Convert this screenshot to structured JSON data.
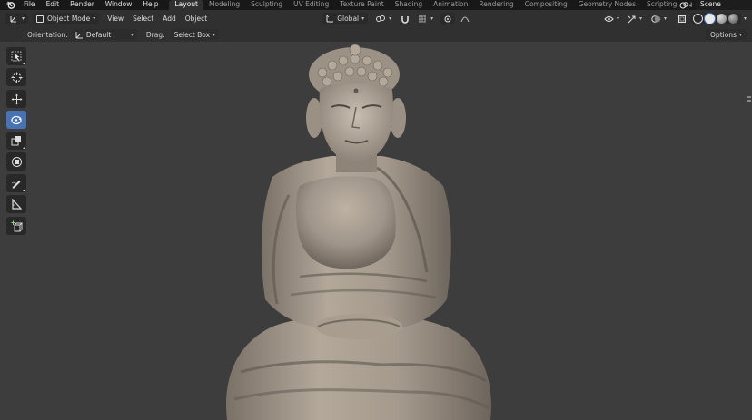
{
  "topbar": {
    "menu": [
      "File",
      "Edit",
      "Render",
      "Window",
      "Help"
    ],
    "workspaces": [
      "Layout",
      "Modeling",
      "Sculpting",
      "UV Editing",
      "Texture Paint",
      "Shading",
      "Animation",
      "Rendering",
      "Compositing",
      "Geometry Nodes",
      "Scripting"
    ],
    "active_workspace": "Layout",
    "add_label": "+",
    "scene_name": "Scene"
  },
  "header": {
    "mode": "Object Mode",
    "menus": [
      "View",
      "Select",
      "Add",
      "Object"
    ],
    "transform_orientation": "Global"
  },
  "tool_settings": {
    "orientation_label": "Orientation:",
    "orientation_value": "Default",
    "drag_label": "Drag:",
    "drag_value": "Select Box",
    "options_label": "Options"
  },
  "toolbar": {
    "tools": [
      "select-box",
      "cursor",
      "move",
      "rotate",
      "scale",
      "transform",
      "annotate",
      "measure",
      "add-cube"
    ],
    "active_tool": "rotate"
  },
  "colors": {
    "accent": "#4772b3",
    "viewport_bg": "#3d3d3d",
    "statue": "#a89d8f"
  }
}
